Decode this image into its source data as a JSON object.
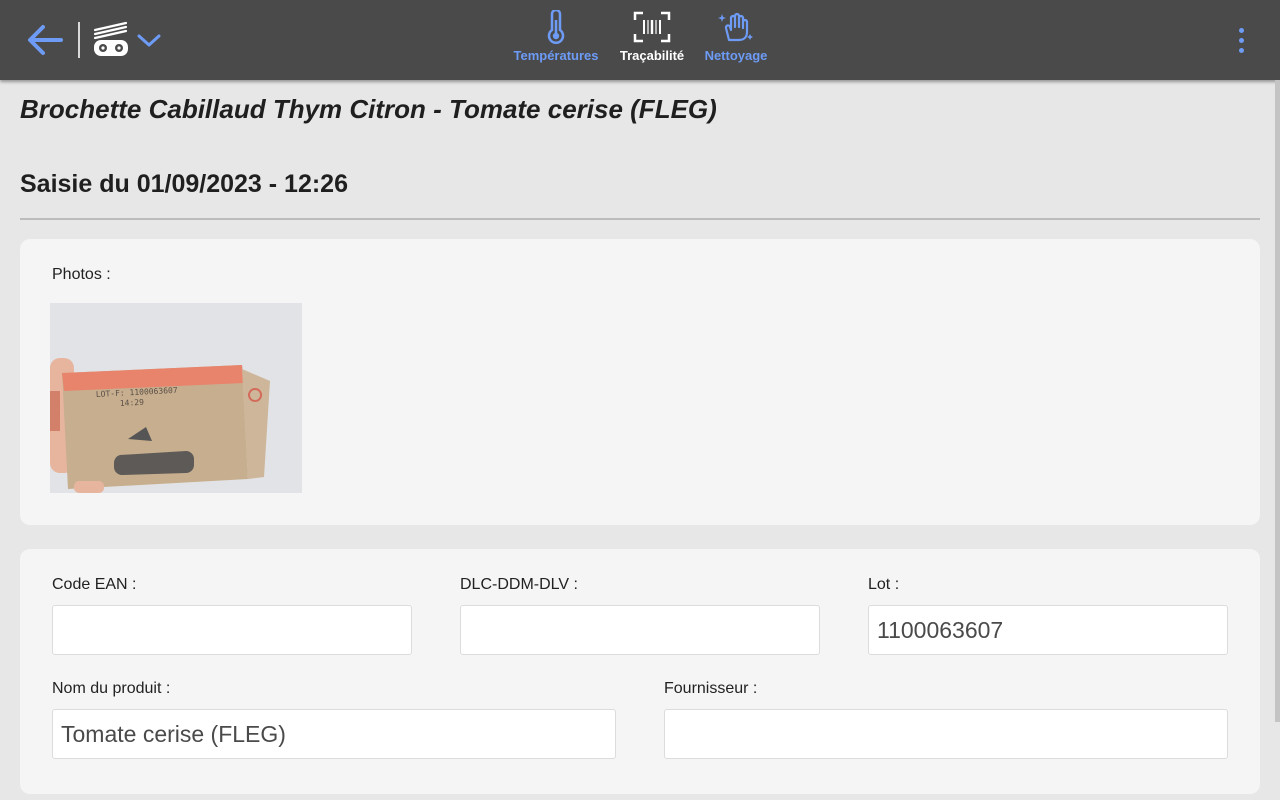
{
  "topbar": {
    "nav": [
      {
        "label": "Températures",
        "icon": "thermometer-icon",
        "active": false
      },
      {
        "label": "Traçabilité",
        "icon": "barcode-scan-icon",
        "active": true
      },
      {
        "label": "Nettoyage",
        "icon": "cleaning-hand-icon",
        "active": false
      }
    ],
    "colors": {
      "bar": "#4a4a4a",
      "accent": "#6d9bf5",
      "active": "#ffffff"
    }
  },
  "page": {
    "product_title": "Brochette Cabillaud Thym Citron - Tomate cerise (FLEG)",
    "entry_title": "Saisie du 01/09/2023 - 12:26"
  },
  "photos": {
    "label": "Photos :",
    "items": [
      {
        "lot_print": "LOT-F: 1100063607",
        "time_print": "14:29"
      }
    ]
  },
  "fields": {
    "ean": {
      "label": "Code EAN :",
      "value": ""
    },
    "dlc": {
      "label": "DLC-DDM-DLV :",
      "value": ""
    },
    "lot": {
      "label": "Lot :",
      "value": "1100063607"
    },
    "product_name": {
      "label": "Nom du produit :",
      "value": "Tomate cerise (FLEG)"
    },
    "supplier": {
      "label": "Fournisseur :",
      "value": ""
    }
  }
}
